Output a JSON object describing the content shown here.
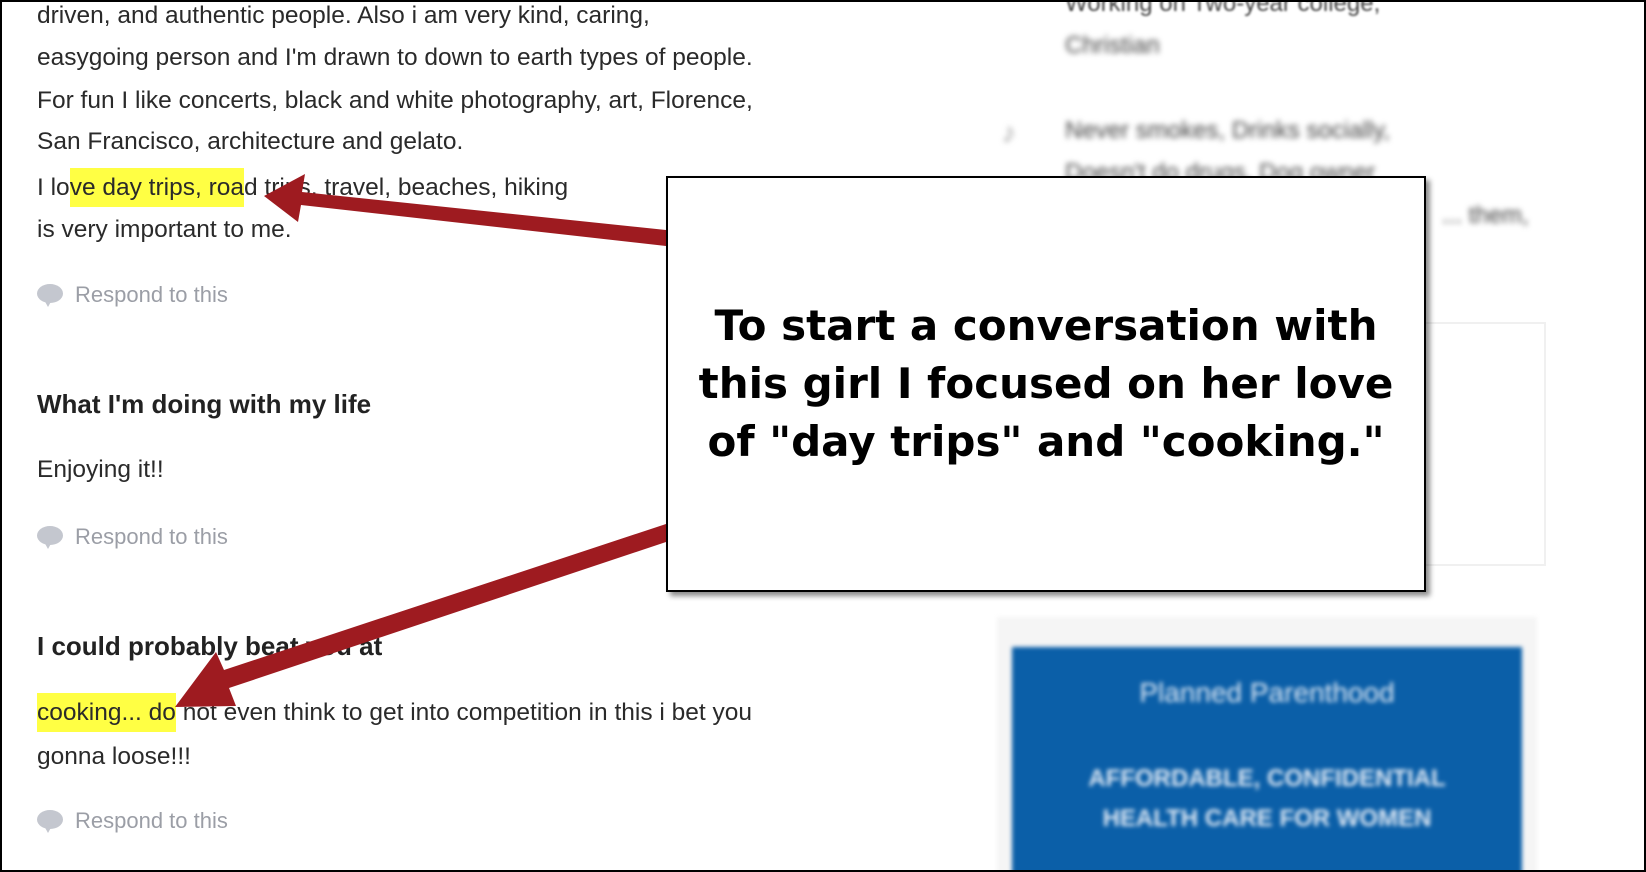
{
  "profile": {
    "about_lines": [
      "driven, and authentic people. Also i am very kind, caring,",
      "easygoing person and I'm drawn to down to earth types of people.",
      "For fun I like concerts, black and white photography, art, Florence,",
      "San Francisco, architecture and gelato."
    ],
    "about_line5": {
      "pre": "I lo",
      "highlight": "ve day trips, roa",
      "post": "d trips, travel, beaches, hiking"
    },
    "about_line6": "is very important to me.",
    "respond_label": "Respond to this",
    "sections": [
      {
        "heading": "What I'm doing with my life",
        "body": "Enjoying it!!"
      },
      {
        "heading": "I could probably beat you at",
        "highlight": "cooking... do",
        "body_rest": " not even think to get into competition in this i bet you",
        "body_line2": "gonna loose!!!"
      }
    ]
  },
  "sidebar": {
    "education": "Working on Two-year college,",
    "religion": "Christian",
    "habits": "Never smokes, Drinks socially,",
    "habits2": "Doesn't do drugs, Dog owner",
    "habits3": "... them,",
    "ad": {
      "brand": "Planned Parenthood",
      "tagline_1": "AFFORDABLE, CONFIDENTIAL",
      "tagline_2": "HEALTH CARE FOR WOMEN"
    }
  },
  "annotation": {
    "callout_text": "To start a conversation with this girl I focused on her love of \"day trips\" and \"cooking.\"",
    "arrow_color": "#9e1b20",
    "highlight_color": "#ffff44"
  }
}
